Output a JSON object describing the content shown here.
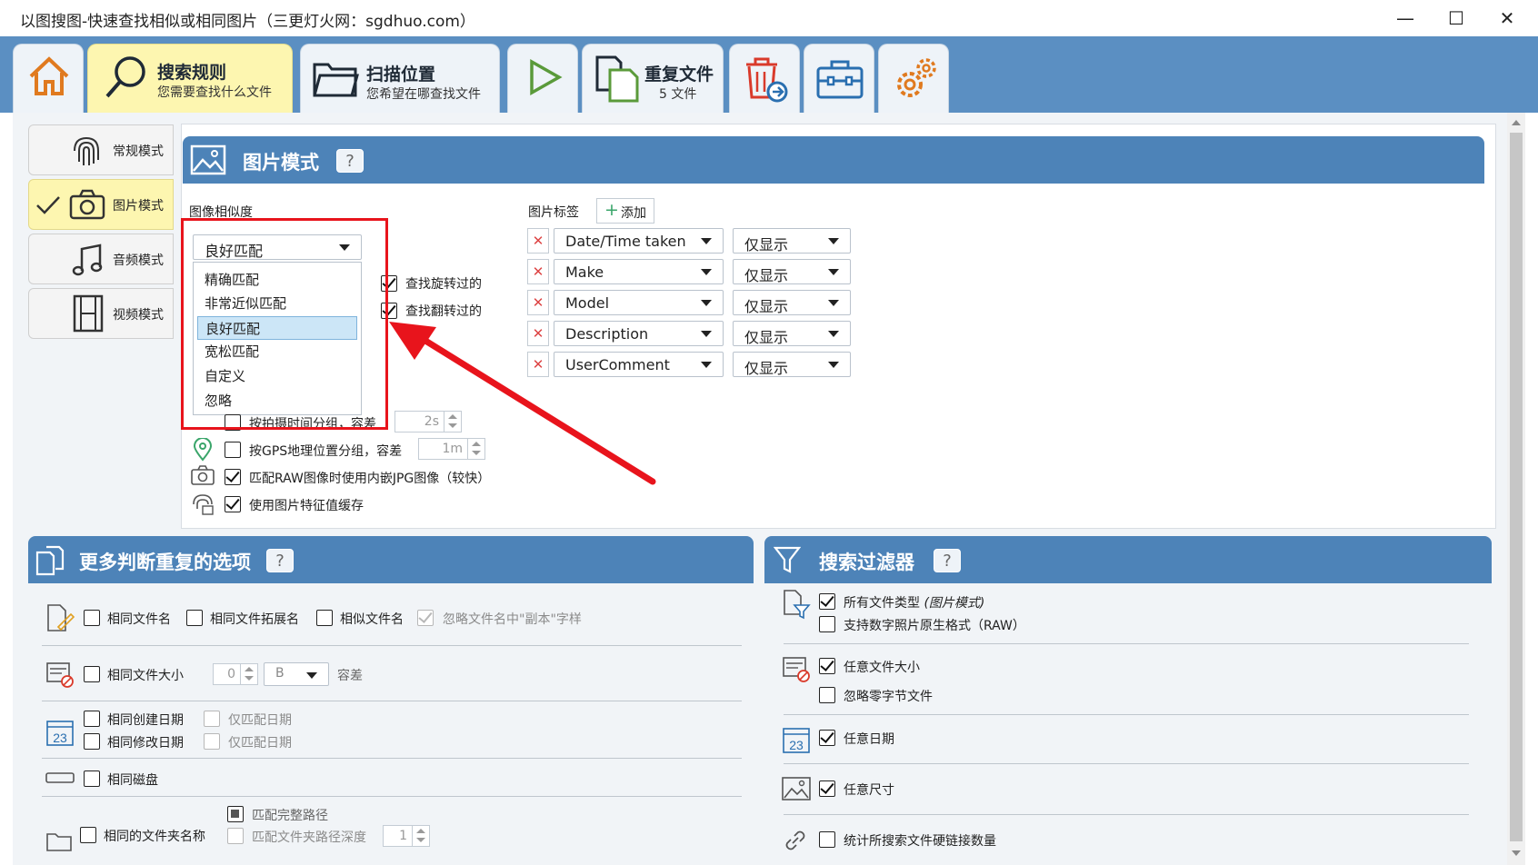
{
  "window": {
    "title": "以图搜图-快速查找相似或相同图片（三更灯火网：sgdhuo.com）",
    "min": "—",
    "max": "☐",
    "close": "✕"
  },
  "toolbar": {
    "search_rules": {
      "title": "搜索规则",
      "subtitle": "您需要查找什么文件"
    },
    "scan_location": {
      "title": "扫描位置",
      "subtitle": "您希望在哪查找文件"
    },
    "duplicates": {
      "title": "重复文件",
      "subtitle": "5 文件"
    }
  },
  "modes": [
    "常规模式",
    "图片模式",
    "音频模式",
    "视频模式"
  ],
  "image_mode": {
    "header": "图片模式",
    "help": "?",
    "similarity_label": "图像相似度",
    "similarity_value": "良好匹配",
    "dropdown_options": [
      "精确匹配",
      "非常近似匹配",
      "良好匹配",
      "宽松匹配",
      "自定义",
      "忽略"
    ],
    "selected_index": 2,
    "find_rotated": "查找旋转过的",
    "find_flipped": "查找翻转过的",
    "group_by_time": "按拍摄时间分组，容差",
    "time_value": "2s",
    "group_by_gps": "按GPS地理位置分组，容差",
    "gps_value": "1m",
    "raw_jpg": "匹配RAW图像时使用内嵌JPG图像（较快）",
    "feature_cache": "使用图片特征值缓存",
    "tags_label": "图片标签",
    "add_label": "添加",
    "tags": [
      {
        "field": "Date/Time taken",
        "mode": "仅显示"
      },
      {
        "field": "Make",
        "mode": "仅显示"
      },
      {
        "field": "Model",
        "mode": "仅显示"
      },
      {
        "field": "Description",
        "mode": "仅显示"
      },
      {
        "field": "UserComment",
        "mode": "仅显示"
      }
    ]
  },
  "more_options": {
    "header": "更多判断重复的选项",
    "help": "?",
    "same_filename": "相同文件名",
    "same_ext": "相同文件拓展名",
    "similar_filename": "相似文件名",
    "ignore_copy": "忽略文件名中\"副本\"字样",
    "same_size": "相同文件大小",
    "size_value": "0",
    "size_unit": "B",
    "tolerance": "容差",
    "same_created": "相同创建日期",
    "same_modified": "相同修改日期",
    "match_date_only": "仅匹配日期",
    "same_disk": "相同磁盘",
    "full_path": "匹配完整路径",
    "path_depth": "匹配文件夹路径深度",
    "depth_value": "1",
    "same_folder": "相同的文件夹名称"
  },
  "filters": {
    "header": "搜索过滤器",
    "help": "?",
    "all_types": "所有文件类型",
    "all_types_note": "(图片模式)",
    "raw_support": "支持数字照片原生格式（RAW）",
    "any_size": "任意文件大小",
    "ignore_zero": "忽略零字节文件",
    "any_date": "任意日期",
    "any_dimension": "任意尺寸",
    "hardlinks": "统计所搜索文件硬链接数量"
  },
  "colors": {
    "toolbar": "#5b8fc2",
    "section_header": "#4d83b8",
    "active_tab": "#fdf6b0",
    "highlight": "#e8141c"
  }
}
